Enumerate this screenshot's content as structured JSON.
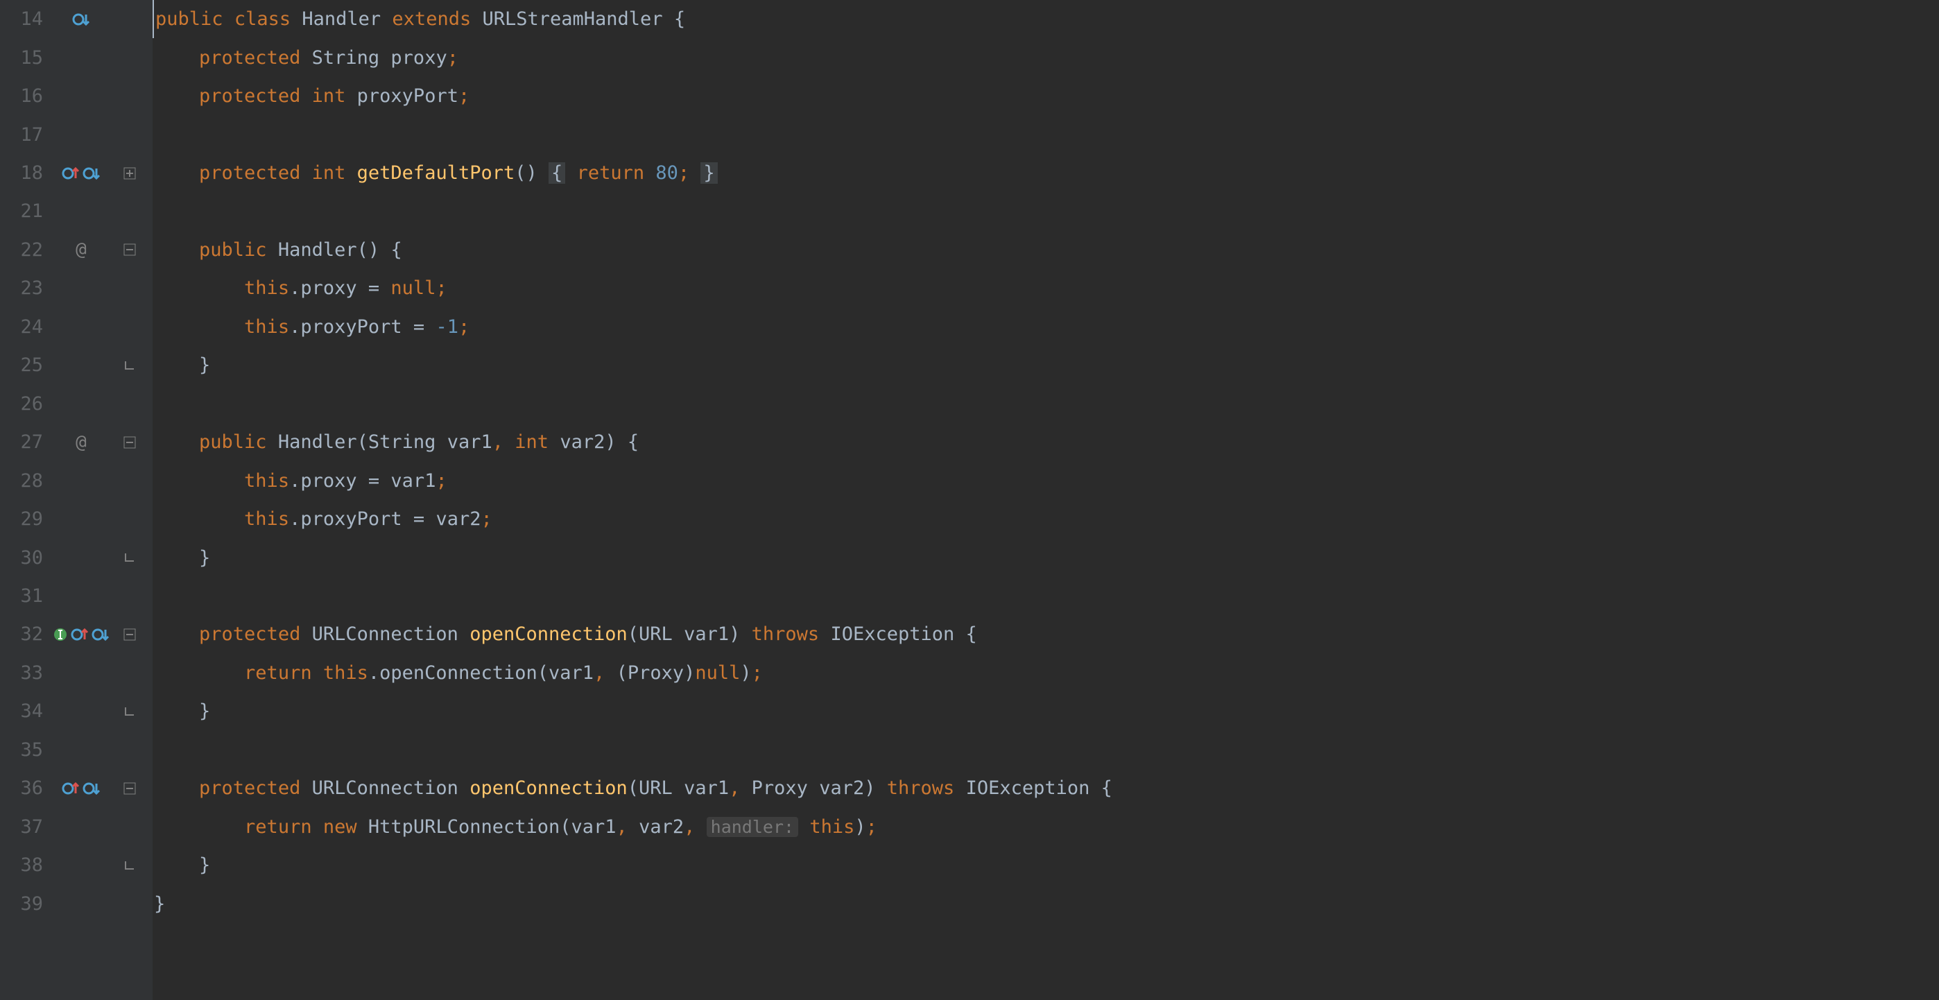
{
  "lines": {
    "l14": {
      "num": "14"
    },
    "l15": {
      "num": "15"
    },
    "l16": {
      "num": "16"
    },
    "l17": {
      "num": "17"
    },
    "l18": {
      "num": "18"
    },
    "l21": {
      "num": "21"
    },
    "l22": {
      "num": "22"
    },
    "l23": {
      "num": "23"
    },
    "l24": {
      "num": "24"
    },
    "l25": {
      "num": "25"
    },
    "l26": {
      "num": "26"
    },
    "l27": {
      "num": "27"
    },
    "l28": {
      "num": "28"
    },
    "l29": {
      "num": "29"
    },
    "l30": {
      "num": "30"
    },
    "l31": {
      "num": "31"
    },
    "l32": {
      "num": "32"
    },
    "l33": {
      "num": "33"
    },
    "l34": {
      "num": "34"
    },
    "l35": {
      "num": "35"
    },
    "l36": {
      "num": "36"
    },
    "l37": {
      "num": "37"
    },
    "l38": {
      "num": "38"
    },
    "l39": {
      "num": "39"
    }
  },
  "kw": {
    "public": "public",
    "class": "class",
    "extends": "extends",
    "protected": "protected",
    "int": "int",
    "return": "return",
    "this": "this",
    "null": "null",
    "throws": "throws",
    "new": "new"
  },
  "id": {
    "Handler": "Handler",
    "URLStreamHandler": "URLStreamHandler",
    "String": "String",
    "proxy": "proxy",
    "proxyPort": "proxyPort",
    "getDefaultPort": "getDefaultPort",
    "var1": "var1",
    "var2": "var2",
    "URLConnection": "URLConnection",
    "openConnection": "openConnection",
    "URL": "URL",
    "IOException": "IOException",
    "Proxy": "Proxy",
    "HttpURLConnection": "HttpURLConnection"
  },
  "num": {
    "eighty": "80",
    "negone": "-1"
  },
  "hint": {
    "handler": "handler:"
  },
  "sym": {
    "obrace": "{",
    "cbrace": "}",
    "oparen": "(",
    "cparen": ")",
    "semi": ";",
    "comma": ",",
    "eq": "=",
    "dot": "."
  }
}
